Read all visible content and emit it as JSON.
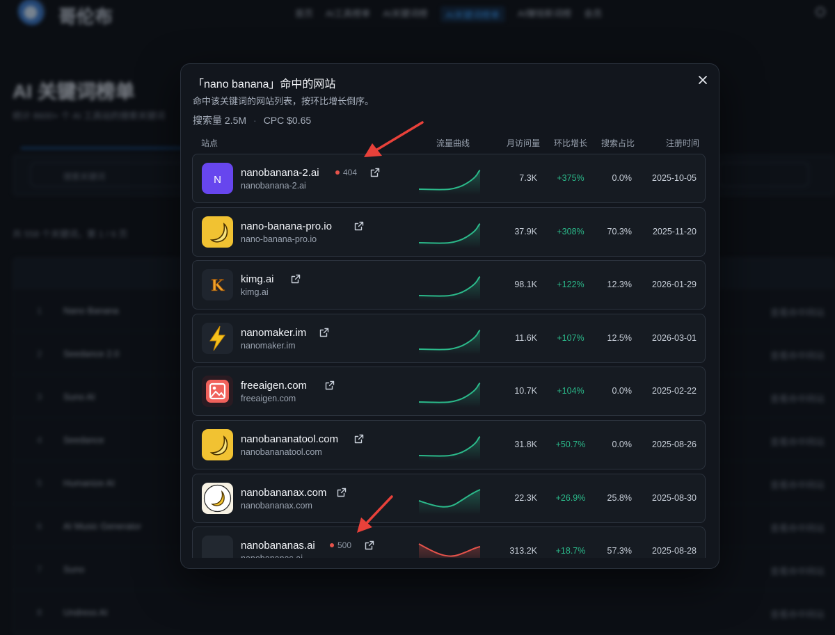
{
  "modal": {
    "title": "「nano banana」命中的网站",
    "description": "命中该关键词的网站列表，按环比增长倒序。",
    "search_volume": "搜索量 2.5M",
    "separator": "·",
    "cpc": "CPC $0.65",
    "columns": {
      "site": "站点",
      "trend": "流量曲线",
      "visits": "月访问量",
      "growth": "环比增长",
      "share": "搜索占比",
      "registered": "注册时间"
    },
    "close_icon": "close-icon"
  },
  "colors": {
    "accent_green": "#2bb98a",
    "trend_red": "#e5534b",
    "status_red": "#e5534b"
  },
  "sites": [
    {
      "name": "nanobanana-2.ai",
      "domain": "nanobanana-2.ai",
      "status": "404",
      "visits": "7.3K",
      "growth": "+375%",
      "share": "0.0%",
      "registered": "2025-10-05",
      "logo_icon": "letter-n-logo",
      "logo_text": "N",
      "trend_direction": "up"
    },
    {
      "name": "nano-banana-pro.io",
      "domain": "nano-banana-pro.io",
      "status": "",
      "visits": "37.9K",
      "growth": "+308%",
      "share": "70.3%",
      "registered": "2025-11-20",
      "logo_icon": "banana-logo",
      "trend_direction": "up"
    },
    {
      "name": "kimg.ai",
      "domain": "kimg.ai",
      "status": "",
      "visits": "98.1K",
      "growth": "+122%",
      "share": "12.3%",
      "registered": "2026-01-29",
      "logo_icon": "letter-k-logo",
      "logo_text": "K",
      "trend_direction": "up"
    },
    {
      "name": "nanomaker.im",
      "domain": "nanomaker.im",
      "status": "",
      "visits": "11.6K",
      "growth": "+107%",
      "share": "12.5%",
      "registered": "2026-03-01",
      "logo_icon": "lightning-logo",
      "trend_direction": "up"
    },
    {
      "name": "freeaigen.com",
      "domain": "freeaigen.com",
      "status": "",
      "visits": "10.7K",
      "growth": "+104%",
      "share": "0.0%",
      "registered": "2025-02-22",
      "logo_icon": "image-logo",
      "trend_direction": "up"
    },
    {
      "name": "nanobananatool.com",
      "domain": "nanobananatool.com",
      "status": "",
      "visits": "31.8K",
      "growth": "+50.7%",
      "share": "0.0%",
      "registered": "2025-08-26",
      "logo_icon": "banana-logo",
      "trend_direction": "up"
    },
    {
      "name": "nanobananax.com",
      "domain": "nanobananax.com",
      "status": "",
      "visits": "22.3K",
      "growth": "+26.9%",
      "share": "25.8%",
      "registered": "2025-08-30",
      "logo_icon": "banana-circle-logo",
      "trend_direction": "dip-up"
    },
    {
      "name": "nanobananas.ai",
      "domain": "nanobananas.ai",
      "status": "500",
      "visits": "313.2K",
      "growth": "+18.7%",
      "share": "57.3%",
      "registered": "2025-08-28",
      "logo_icon": "blank-logo",
      "trend_direction": "down-up"
    }
  ]
}
